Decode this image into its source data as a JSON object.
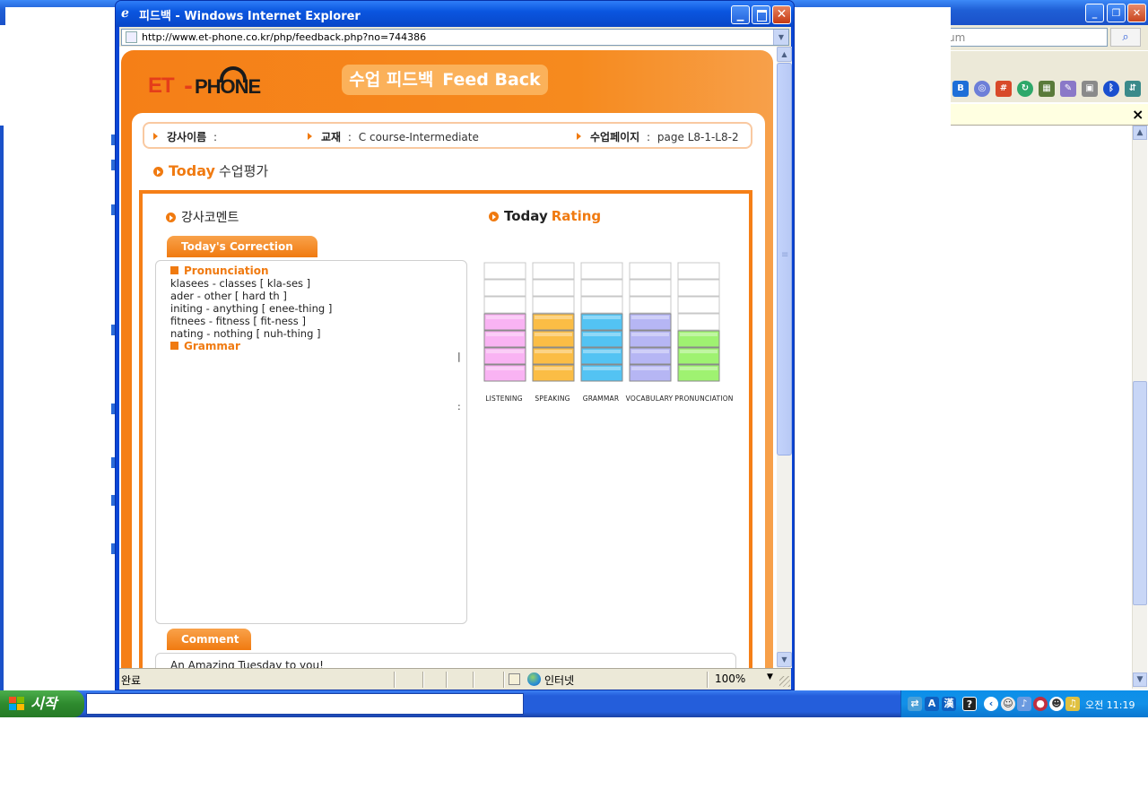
{
  "background_window": {
    "title": "",
    "search_placeholder": "um",
    "search_button_icon": "search-icon",
    "infobar_close": "×"
  },
  "taskbar": {
    "start_label": "시작",
    "clock": "오전 11:19",
    "tray_icons": [
      "network-icon",
      "ime-a-icon",
      "hanja-icon",
      "help-icon",
      "arrow-left-icon",
      "messenger-icon",
      "volume-icon",
      "antivirus-icon",
      "chat-icon",
      "sound-icon"
    ]
  },
  "popup": {
    "title": "피드백 - Windows Internet Explorer",
    "url": "http://www.et-phone.co.kr/php/feedback.php?no=744386",
    "status": {
      "text": "완료",
      "zone": "인터넷",
      "zoom": "100%"
    }
  },
  "page": {
    "logo": {
      "et": "ET",
      "dash": "-",
      "phone": "PHONE"
    },
    "header_title_ko": "수업 피드백",
    "header_title_en": "Feed Back",
    "info": {
      "teacher_label": "강사이름",
      "teacher_value": "",
      "textbook_label": "교재",
      "textbook_value": "C course-Intermediate",
      "page_label": "수업페이지",
      "page_value": "page L8-1-L8-2",
      "colon": ":"
    },
    "today_eval": {
      "today": "Today",
      "title": "수업평가"
    },
    "teacher_comment_heading": "강사코멘트",
    "correction_tab": "Today's Correction",
    "correction": {
      "pronunciation_heading": "Pronunciation",
      "lines": [
        "klasees - classes [ kla-ses ]",
        "ader - other [ hard th ]",
        "initing - anything [ enee-thing ]",
        "fitnees - fitness [ fit-ness ]",
        "nating - nothing [ nuh-thing ]"
      ],
      "grammar_heading": "Grammar",
      "mark_bar": "|",
      "mark_colon": ":"
    },
    "comment_tab": "Comment",
    "comment_text": "An Amazing Tuesday to you!",
    "rating_heading": {
      "today": "Today",
      "rating": "Rating"
    }
  },
  "chart_data": {
    "type": "bar",
    "title": "Today Rating",
    "categories": [
      "LISTENING",
      "SPEAKING",
      "GRAMMAR",
      "VOCABULARY",
      "PRONUNCIATION"
    ],
    "values": [
      4,
      4,
      4,
      4,
      3
    ],
    "max": 7,
    "colors": [
      "#f9b3f3",
      "#fbbd45",
      "#53c3f3",
      "#b6b6f4",
      "#9ff271"
    ]
  }
}
